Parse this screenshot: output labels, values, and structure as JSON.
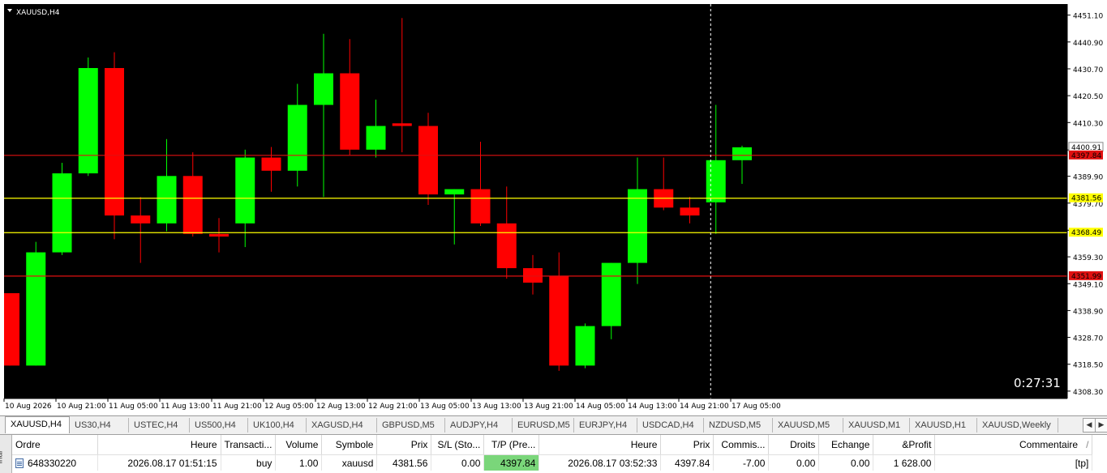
{
  "chart_data": {
    "type": "candlestick",
    "title": "XAUUSD,H4",
    "ylim": [
      4305.5,
      4455.3
    ],
    "y_ticks": [
      "4451.10",
      "4440.90",
      "4430.70",
      "4420.50",
      "4410.30",
      "4399.89",
      "4389.90",
      "4379.70",
      "4369.40",
      "4359.30",
      "4349.10",
      "4338.90",
      "4328.70",
      "4318.50",
      "4308.30"
    ],
    "x_labels": [
      "10 Aug 2026",
      "10 Aug 21:00",
      "11 Aug 05:00",
      "11 Aug 13:00",
      "11 Aug 21:00",
      "12 Aug 05:00",
      "12 Aug 13:00",
      "12 Aug 21:00",
      "13 Aug 05:00",
      "13 Aug 13:00",
      "13 Aug 21:00",
      "14 Aug 05:00",
      "14 Aug 13:00",
      "14 Aug 21:00",
      "17 Aug 05:00"
    ],
    "candles": [
      {
        "o": 4345.5,
        "h": 4345.5,
        "l": 4318.0,
        "c": 4318.0
      },
      {
        "o": 4318.0,
        "h": 4365.0,
        "l": 4318.0,
        "c": 4361.0
      },
      {
        "o": 4361.0,
        "h": 4395.0,
        "l": 4360.0,
        "c": 4391.0
      },
      {
        "o": 4391.0,
        "h": 4435.0,
        "l": 4390.0,
        "c": 4431.0
      },
      {
        "o": 4431.0,
        "h": 4437.0,
        "l": 4366.0,
        "c": 4375.0
      },
      {
        "o": 4375.0,
        "h": 4382.0,
        "l": 4357.0,
        "c": 4372.0
      },
      {
        "o": 4372.0,
        "h": 4404.0,
        "l": 4369.0,
        "c": 4390.0
      },
      {
        "o": 4390.0,
        "h": 4399.0,
        "l": 4367.0,
        "c": 4368.0
      },
      {
        "o": 4368.0,
        "h": 4374.0,
        "l": 4361.0,
        "c": 4367.0
      },
      {
        "o": 4372.0,
        "h": 4400.0,
        "l": 4363.0,
        "c": 4397.0
      },
      {
        "o": 4397.0,
        "h": 4401.0,
        "l": 4384.0,
        "c": 4392.0
      },
      {
        "o": 4392.0,
        "h": 4425.0,
        "l": 4386.0,
        "c": 4417.0
      },
      {
        "o": 4417.0,
        "h": 4444.0,
        "l": 4382.0,
        "c": 4429.0
      },
      {
        "o": 4429.0,
        "h": 4442.0,
        "l": 4398.0,
        "c": 4400.0
      },
      {
        "o": 4400.0,
        "h": 4419.0,
        "l": 4397.0,
        "c": 4409.0
      },
      {
        "o": 4410.0,
        "h": 4450.0,
        "l": 4399.0,
        "c": 4409.0
      },
      {
        "o": 4409.0,
        "h": 4414.0,
        "l": 4379.0,
        "c": 4383.0
      },
      {
        "o": 4383.0,
        "h": 4385.0,
        "l": 4364.0,
        "c": 4385.0
      },
      {
        "o": 4385.0,
        "h": 4403.0,
        "l": 4371.0,
        "c": 4372.0
      },
      {
        "o": 4372.0,
        "h": 4386.0,
        "l": 4351.0,
        "c": 4355.0
      },
      {
        "o": 4355.0,
        "h": 4360.0,
        "l": 4345.0,
        "c": 4349.5
      },
      {
        "o": 4352.0,
        "h": 4361.0,
        "l": 4316.0,
        "c": 4318.0
      },
      {
        "o": 4318.0,
        "h": 4334.0,
        "l": 4317.0,
        "c": 4333.0
      },
      {
        "o": 4333.0,
        "h": 4357.0,
        "l": 4328.0,
        "c": 4357.0
      },
      {
        "o": 4357.0,
        "h": 4397.0,
        "l": 4349.0,
        "c": 4385.0
      },
      {
        "o": 4385.0,
        "h": 4397.0,
        "l": 4377.0,
        "c": 4378.0
      },
      {
        "o": 4378.0,
        "h": 4382.0,
        "l": 4372.0,
        "c": 4375.0
      },
      {
        "o": 4380.0,
        "h": 4417.0,
        "l": 4368.0,
        "c": 4396.0
      },
      {
        "o": 4396.0,
        "h": 4401.5,
        "l": 4387.0,
        "c": 4400.9
      }
    ],
    "h_lines": [
      {
        "price": 4397.84,
        "label": "4397.84",
        "color": "#e01010",
        "label_bg": "#e01010",
        "label_fg": "#000000"
      },
      {
        "price": 4381.56,
        "label": "4381.56",
        "color": "#ffff00",
        "label_bg": "#ffff00",
        "label_fg": "#000000"
      },
      {
        "price": 4368.49,
        "label": "4368.49",
        "color": "#ffff00",
        "label_bg": "#ffff00",
        "label_fg": "#000000"
      },
      {
        "price": 4351.99,
        "label": "4351.99",
        "color": "#e01010",
        "label_bg": "#e01010",
        "label_fg": "#000000"
      }
    ],
    "current_price_label": "4400.91",
    "countdown": "0:27:31",
    "colors": {
      "bull": "#00ff00",
      "bear": "#ff0000",
      "background": "#000000",
      "axis_text": "#ffffff"
    }
  },
  "tabs": [
    "XAUUSD,H4",
    "US30,H4",
    "USTEC,H4",
    "US500,H4",
    "UK100,H4",
    "XAGUSD,H4",
    "GBPUSD,M5",
    "AUDJPY,H4",
    "EURUSD,M5",
    "EURJPY,H4",
    "USDCAD,H4",
    "NZDUSD,M5",
    "XAUUSD,M5",
    "XAUUSD,M1",
    "XAUUSD,H1",
    "XAUUSD,Weekly"
  ],
  "terminal": {
    "side_label": "inal",
    "headers": [
      "Ordre",
      "Heure",
      "Transacti...",
      "Volume",
      "Symbole",
      "Prix",
      "S/L (Sto...",
      "T/P (Pre...",
      "Heure",
      "Prix",
      "Commis...",
      "Droits",
      "Echange",
      "&Profit",
      "Commentaire"
    ],
    "row": [
      "648330220",
      "2026.08.17 01:51:15",
      "buy",
      "1.00",
      "xauusd",
      "4381.56",
      "0.00",
      "4397.84",
      "2026.08.17 03:52:33",
      "4397.84",
      "-7.00",
      "0.00",
      "0.00",
      "1 628.00",
      "[tp]"
    ],
    "sort_mark": "/"
  }
}
